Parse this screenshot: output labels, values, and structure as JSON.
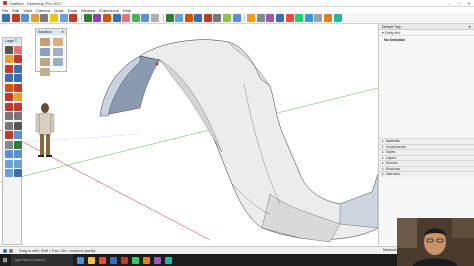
{
  "window": {
    "title": "Untitled - SketchUp Pro 2017",
    "controls": [
      "–",
      "□",
      "✕"
    ]
  },
  "menu": [
    "File",
    "Edit",
    "View",
    "Camera",
    "Draw",
    "Tools",
    "Window",
    "Extensions",
    "Help"
  ],
  "toolbar": {
    "colors": [
      "#3b6db5",
      "#c0392b",
      "#5b8fd6",
      "#e0a032",
      "#7a7a7a",
      "#f1c40f",
      "#6aa0d8",
      "#c0392b",
      "#2e7d32",
      "#8e44ad",
      "#d35400",
      "#3b6db5",
      "#e57373",
      "#4caf50",
      "#5b8fd6",
      "#b0b0b0",
      "#2e7d32",
      "#6aa0d8",
      "#d35400",
      "#3b6db5",
      "#c0392b",
      "#7a7a7a",
      "#8bc34a",
      "#5b8fd6",
      "#f39c12",
      "#7f8c8d",
      "#9b59b6",
      "#3b6db5",
      "#e74c3c",
      "#2ecc71",
      "#3498db",
      "#95a5a6",
      "#e67e22",
      "#1abc9c"
    ]
  },
  "palette": {
    "title": "Large T.",
    "icons": [
      "select-icon",
      "eraser-icon",
      "paint-icon",
      "line-icon",
      "arc-icon",
      "rect-icon",
      "circle-icon",
      "polygon-icon",
      "push-pull-icon",
      "move-icon",
      "rotate-icon",
      "scale-icon",
      "offset-icon",
      "follow-me-icon",
      "tape-icon",
      "protractor-icon",
      "dimension-icon",
      "text-icon",
      "axes-icon",
      "section-icon",
      "orbit-icon",
      "pan-icon",
      "zoom-icon",
      "zoom-extents-icon",
      "walk-icon",
      "look-icon",
      "position-camera-icon",
      "prev-view-icon"
    ],
    "colors": [
      "#555",
      "#e57373",
      "#e0a032",
      "#c0392b",
      "#c0392b",
      "#3b6db5",
      "#3b6db5",
      "#3b6db5",
      "#d35400",
      "#c0392b",
      "#c0392b",
      "#e0a032",
      "#c0392b",
      "#c0392b",
      "#777",
      "#777",
      "#777",
      "#555",
      "#c0392b",
      "#5b8fd6",
      "#7f8c8d",
      "#2e7d32",
      "#5b8fd6",
      "#5b8fd6",
      "#6aa0d8",
      "#6aa0d8",
      "#6aa0d8",
      "#3b6db5"
    ]
  },
  "sandbox": {
    "title": "Sandbox",
    "icons": [
      "from-contours-icon",
      "from-scratch-icon",
      "smoove-icon",
      "stamp-icon",
      "drape-icon",
      "add-detail-icon",
      "flip-edge-icon"
    ]
  },
  "tray": {
    "title": "Default Tray",
    "entity_info_label": "Entity Info",
    "entity_info_value": "No Selection",
    "panels": [
      "Materials",
      "Components",
      "Styles",
      "Layers",
      "Scenes",
      "Shadows",
      "Instructor"
    ]
  },
  "status": {
    "hint": "Drag to orbit. Shift = Pan, Ctrl = suspend gravity.",
    "measure_label": "Measurements"
  },
  "taskbar": {
    "search": "Type here to search",
    "app_colors": [
      "#4a90d9",
      "#f5c542",
      "#e74c3c",
      "#3b6db5",
      "#c0392b",
      "#2ecc71",
      "#e67e22",
      "#9b59b6",
      "#1abc9c"
    ]
  }
}
